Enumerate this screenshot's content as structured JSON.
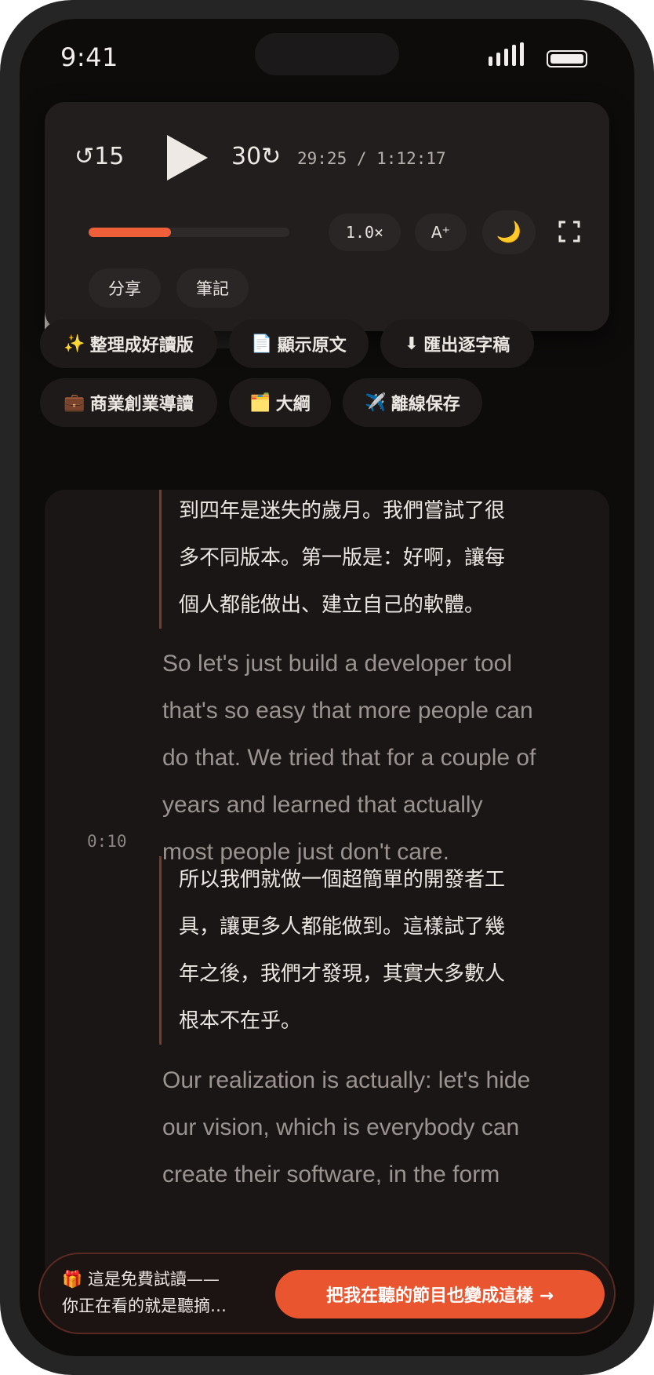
{
  "status_bar": {
    "time": "9:41"
  },
  "player": {
    "skip_back_label": "↺15",
    "skip_forward_label": "30↻",
    "time_readout": "29:25 / 1:12:17",
    "progress_fraction": 0.41,
    "speed_label": "1.0×",
    "font_size_label": "A⁺",
    "theme_icon": "🌙",
    "share_label": "分享",
    "note_label": "筆記",
    "accent_color": "#ee5f3a"
  },
  "actions": [
    {
      "emoji": "✨",
      "label": "整理成好讀版"
    },
    {
      "emoji": "📄",
      "label": "顯示原文"
    },
    {
      "emoji": "⬇",
      "label": "匯出逐字稿"
    },
    {
      "emoji": "💼",
      "label": "商業創業導讀"
    },
    {
      "emoji": "🗂️",
      "label": "大綱"
    },
    {
      "emoji": "✈️",
      "label": "離線保存"
    }
  ],
  "transcript": {
    "zh_1": [
      "到四年是迷失的歲月。我們嘗試了很",
      "多不同版本。第一版是：好啊，讓每",
      "個人都能做出、建立自己的軟體。"
    ],
    "en_1": [
      "So let's just build a developer tool",
      "that's so easy that more people can",
      "do that. We tried that for a couple of",
      "years and learned that actually",
      "most people just don't care."
    ],
    "timestamp_1": "0:10",
    "zh_2": [
      "所以我們就做一個超簡單的開發者工",
      "具，讓更多人都能做到。這樣試了幾",
      "年之後，我們才發現，其實大多數人",
      "根本不在乎。"
    ],
    "en_2": [
      "Our realization is actually: let's hide",
      "our vision, which is everybody can",
      "create their software, in the form"
    ]
  },
  "banner": {
    "line_1": "🎁 這是免費試讀——",
    "line_2": "你正在看的就是聽摘…",
    "cta_label": "把我在聽的節目也變成這樣 →"
  }
}
